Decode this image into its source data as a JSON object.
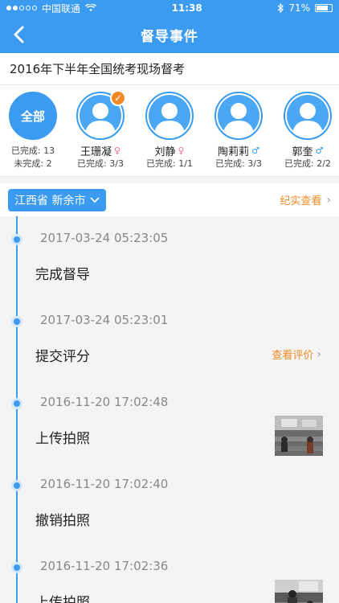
{
  "status": {
    "carrier": "中国联通",
    "time": "11:38",
    "battery": "71%",
    "battery_level": 0.71
  },
  "nav": {
    "title": "督导事件"
  },
  "exam_title": "2016年下半年全国统考现场督考",
  "all": {
    "label": "全部",
    "done": "已完成: 13",
    "undone": "未完成: 2"
  },
  "people": [
    {
      "name": "王珊凝",
      "gender": "♀",
      "done": "已完成: 3/3",
      "selected": true
    },
    {
      "name": "刘静",
      "gender": "♀",
      "done": "已完成: 1/1",
      "selected": false
    },
    {
      "name": "陶莉莉",
      "gender": "♂",
      "done": "已完成: 3/3",
      "selected": false
    },
    {
      "name": "郭奎",
      "gender": "♂",
      "done": "已完成: 2/2",
      "selected": false
    }
  ],
  "filter": {
    "region": "江西省 新余市",
    "records_link": "纪实查看"
  },
  "events": [
    {
      "time": "2017-03-24 05:23:05",
      "text": "完成督导"
    },
    {
      "time": "2017-03-24 05:23:01",
      "text": "提交评分",
      "link": "查看评价"
    },
    {
      "time": "2016-11-20 17:02:48",
      "text": "上传拍照",
      "photo": "classroom-photo"
    },
    {
      "time": "2016-11-20 17:02:40",
      "text": "撤销拍照"
    },
    {
      "time": "2016-11-20 17:02:36",
      "text": "上传拍照",
      "photo": "classroom-photo"
    }
  ],
  "colors": {
    "primary": "#3a9bf0",
    "accent": "#f08a24"
  }
}
